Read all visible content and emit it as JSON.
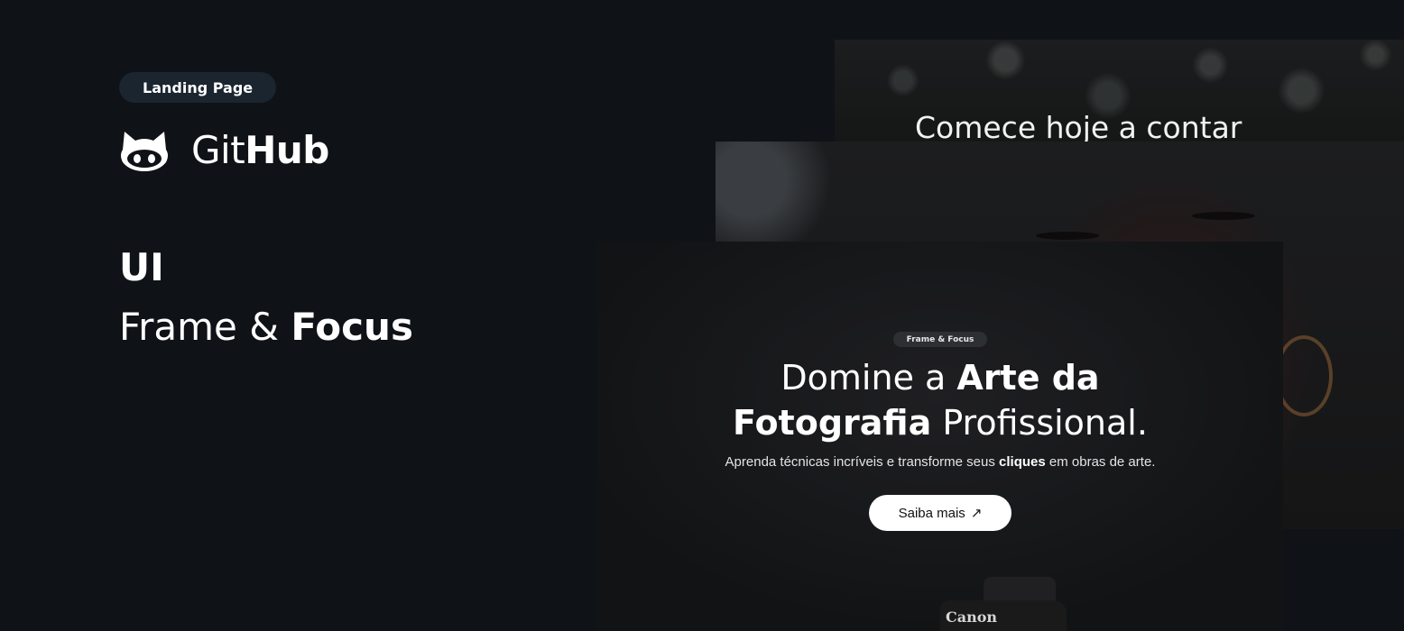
{
  "left": {
    "badge": "Landing Page",
    "brand": {
      "light": "Git",
      "bold": "Hub",
      "icon": "github-octocat-icon"
    },
    "section_label": "UI",
    "project": {
      "light": "Frame & ",
      "bold": "Focus"
    }
  },
  "preview": {
    "back_frame": {
      "title": "Comece hoje a contar"
    },
    "main_frame": {
      "pill": "Frame & Focus",
      "headline_line1_a": "Domine a ",
      "headline_line1_b": "Arte da",
      "headline_line2_a": "Fotografia",
      "headline_line2_b": " Profissional.",
      "subline_a": "Aprenda técnicas incríveis e transforme seus ",
      "subline_bold": "cliques",
      "subline_b": " em obras de arte.",
      "cta_label": "Saiba mais",
      "cta_icon": "↗",
      "camera_brand": "Canon"
    }
  },
  "colors": {
    "background": "#0f1216",
    "badge_bg": "#1b2530",
    "cta_bg": "#ffffff"
  }
}
